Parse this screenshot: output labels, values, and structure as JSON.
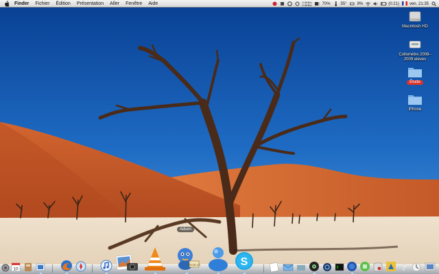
{
  "menubar": {
    "app_name": "Finder",
    "menus": [
      "Fichier",
      "Édition",
      "Présentation",
      "Aller",
      "Fenêtre",
      "Aide"
    ],
    "status": {
      "net_up": "0.0KB/s",
      "net_down": "0.0KB/s",
      "cpu_percent": "70%",
      "temperature": "55°",
      "battery_small": "9%",
      "battery_time": "(0:21)",
      "flag": "fr",
      "datetime": "ven. 21:35"
    }
  },
  "desktop": {
    "icons": [
      {
        "label": "Macintosh HD",
        "icon": "hard-drive-icon"
      },
      {
        "label": "Collomètre 2008–2009 eleves",
        "icon": "disk-image-icon"
      },
      {
        "label": "Étude",
        "icon": "folder-icon",
        "tag_color": "#d9332c"
      },
      {
        "label": "iPhone",
        "icon": "folder-icon"
      }
    ]
  },
  "dock": {
    "tooltip": "Adium",
    "items": [
      "system-preferences-icon",
      "ical-icon",
      "address-book-icon",
      "preview-icon",
      "firefox-icon",
      "safari-icon",
      "itunes-icon",
      "iphoto-icon",
      "photo-booth-icon",
      "vlc-icon",
      "adium-icon",
      "msn-icon",
      "skype-icon",
      "textedit-icon",
      "mail-icon",
      "dvd-player-icon",
      "quicktime-icon",
      "terminal-icon",
      "network-icon",
      "activity-monitor-icon",
      "grab-icon",
      "script-editor-icon",
      "help-icon",
      "time-machine-icon",
      "calculator-icon",
      "downloads-stack-icon"
    ]
  },
  "colors": {
    "sky_top": "#0a4fa8",
    "sky_bottom": "#3b86d1",
    "dune": "#c8602e",
    "pan": "#ead9c4",
    "tree": "#4a2a18"
  }
}
